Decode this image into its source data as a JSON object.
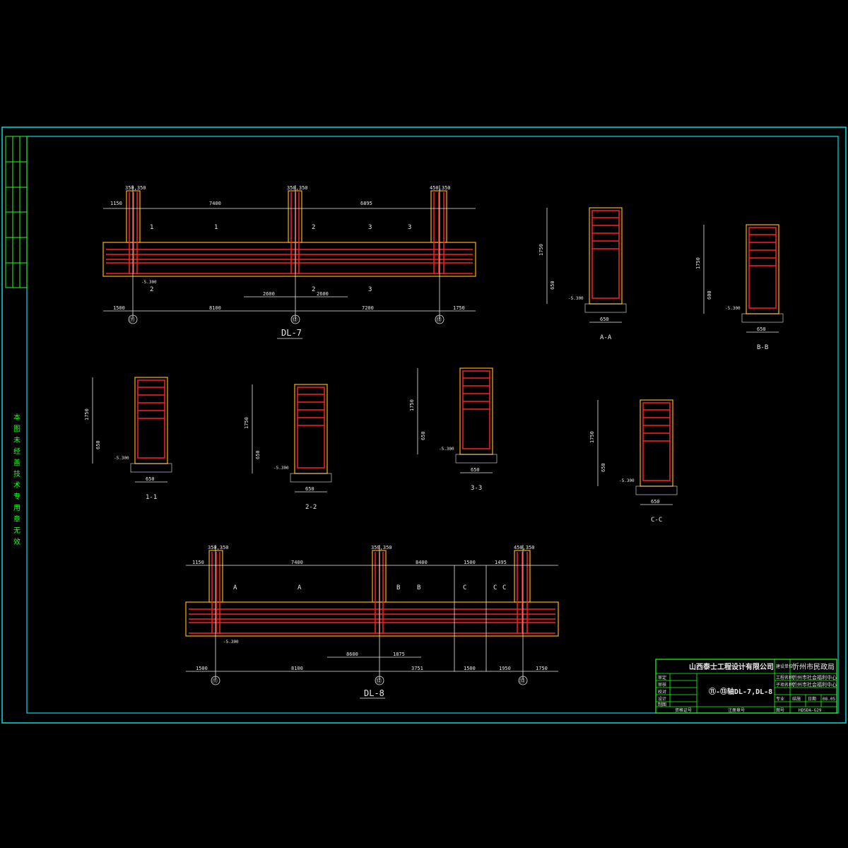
{
  "side_note": "本图未经盖技术专用章无效",
  "title_block": {
    "company": "山西泰士工程设计有限公司",
    "client_label": "建设单位",
    "client": "忻州市民政局",
    "project_label": "工程名称",
    "project": "忻州市社会福利中心",
    "subproject_label": "子项名称",
    "subproject": "忻州市社会福利中心",
    "drawing_title": "⑪-⑬轴DL-7,DL-8",
    "approved_label": "审定",
    "reviewed_label": "审核",
    "checked_label": "校对",
    "designed_label": "设计",
    "drawn_label": "制图",
    "stage_label": "专业",
    "stage": "结施",
    "date_label": "日期",
    "date": "08.05",
    "drawing_no_label": "图号",
    "drawing_no": "HDSDA-G29",
    "cert_label": "资格证号",
    "seal_label": "注册章号"
  },
  "views": {
    "dl7": {
      "title": "DL-7",
      "col_labels": [
        "350,350",
        "350,350",
        "450,350"
      ],
      "dims_bottom": [
        "1500",
        "8100",
        "7200",
        "1750"
      ],
      "dims_top": [
        "1150",
        "7400",
        "6895"
      ],
      "axes": [
        "⑪",
        "⑫",
        "⑬"
      ],
      "sections": [
        "1",
        "1",
        "2",
        "3",
        "3",
        "2",
        "2",
        "3"
      ],
      "mid_dims": [
        "2600",
        "2600"
      ],
      "level": "-5.300"
    },
    "dl8": {
      "title": "DL-8",
      "col_labels": [
        "350,350",
        "350,350",
        "450,350"
      ],
      "dims_bottom": [
        "1500",
        "8100",
        "3751",
        "1500",
        "1950",
        "1750"
      ],
      "dims_top": [
        "1150",
        "7400",
        "8400",
        "1500",
        "1495"
      ],
      "axes": [
        "⑪",
        "⑫",
        "⑬"
      ],
      "sections": [
        "A",
        "A",
        "B",
        "B",
        "C",
        "C",
        "C"
      ],
      "mid_dims": [
        "8600",
        "1875"
      ],
      "level": "-5.300"
    },
    "sec_AA": {
      "title": "A-A",
      "width": "650",
      "height": "1750",
      "sub": "650",
      "level": "-5.300"
    },
    "sec_BB": {
      "title": "B-B",
      "width": "650",
      "height": "1750",
      "sub": "600",
      "level": "-5.300"
    },
    "sec_11": {
      "title": "1-1",
      "width": "650",
      "height": "1750",
      "sub": "650",
      "level": "-5.300"
    },
    "sec_22": {
      "title": "2-2",
      "width": "650",
      "height": "1750",
      "sub": "650",
      "level": "-5.300"
    },
    "sec_33": {
      "title": "3-3",
      "width": "650",
      "height": "1750",
      "sub": "650",
      "level": "-5.300"
    },
    "sec_CC": {
      "title": "C-C",
      "width": "650",
      "height": "1750",
      "sub": "650",
      "level": "-5.300"
    }
  }
}
